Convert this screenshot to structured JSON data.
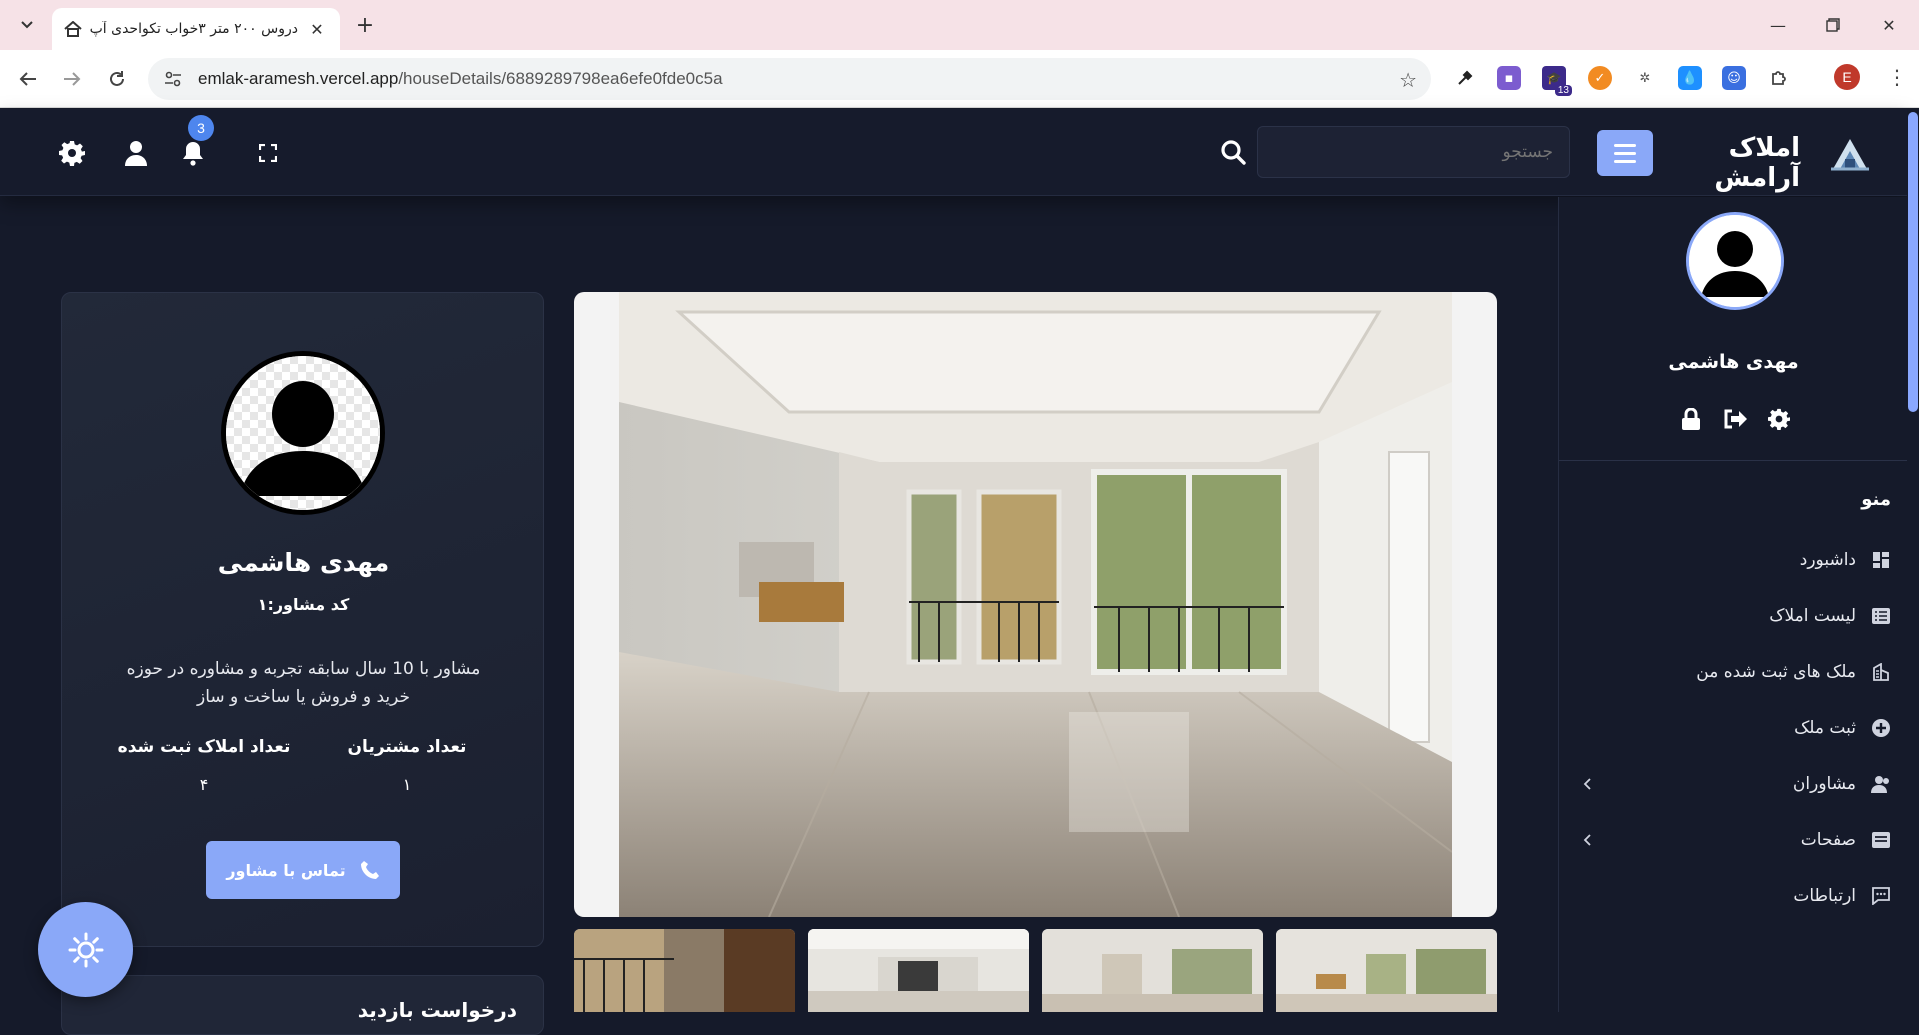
{
  "browser": {
    "tab_title": "دروس ۲۰۰ متر ۳خواب تکواحدی آپ",
    "url_host": "emlak-aramesh.vercel.app",
    "url_path": "/houseDetails/6889289798ea6efe0fde0c5a",
    "profile_initial": "E",
    "extension_badge": "13"
  },
  "topbar": {
    "brand_name": "املاک آرامش",
    "search_placeholder": "جستجو",
    "notification_count": "3"
  },
  "sidebar": {
    "user_name": "مهدی هاشمی",
    "menu_title": "منو",
    "items": [
      {
        "label": "داشبورد",
        "icon": "dashboard-icon",
        "has_submenu": false
      },
      {
        "label": "لیست املاک",
        "icon": "list-icon",
        "has_submenu": false
      },
      {
        "label": "ملک های ثبت شده من",
        "icon": "building-icon",
        "has_submenu": false
      },
      {
        "label": "ثبت ملک",
        "icon": "plus-circle-icon",
        "has_submenu": false
      },
      {
        "label": "مشاوران",
        "icon": "users-icon",
        "has_submenu": true
      },
      {
        "label": "صفحات",
        "icon": "pages-icon",
        "has_submenu": true
      },
      {
        "label": "ارتباطات",
        "icon": "chat-icon",
        "has_submenu": false
      }
    ]
  },
  "agent": {
    "name": "مهدی هاشمی",
    "code": "کد مشاور:۱",
    "bio": "مشاور با 10 سال سابقه تجربه و مشاوره در حوزه خرید و فروش یا ساخت و ساز",
    "stats": [
      {
        "label": "تعداد مشتریان",
        "value": "۱"
      },
      {
        "label": "تعداد املاک ثبت شده",
        "value": "۴"
      }
    ],
    "contact_label": "تماس با مشاور"
  },
  "request": {
    "title": "درخواست بازدید"
  },
  "colors": {
    "accent": "#8aa8f8",
    "background": "#151a2a",
    "badge": "#4e86ee"
  }
}
